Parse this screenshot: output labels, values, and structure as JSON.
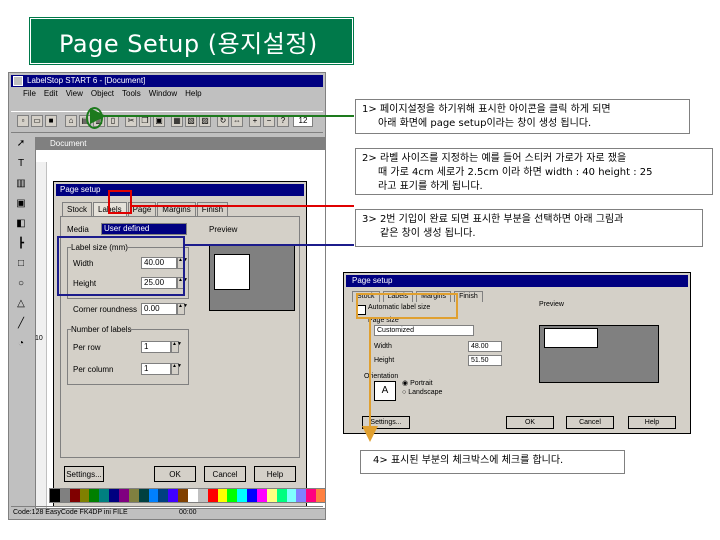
{
  "title": "Page Setup (용지설정)",
  "app": {
    "window_title": "LabelStop START 6 - [Document]",
    "menu": [
      "File",
      "Edit",
      "View",
      "Object",
      "Tools",
      "Window",
      "Help"
    ],
    "document_title": "Document",
    "zoom_value": "12",
    "ruler_marker": "10",
    "status_left": "Code:128 EasyCode FK4DP ini FILE",
    "status_right": "00:00"
  },
  "dialog": {
    "title": "Page setup",
    "tabs": [
      "Stock",
      "Labels",
      "Page",
      "Margins",
      "Finish"
    ],
    "media_label": "Media",
    "media_value": "User defined",
    "preview_label": "Preview",
    "label_size_group": "Label size (mm)",
    "width_label": "Width",
    "width_value": "40.00",
    "height_label": "Height",
    "height_value": "25.00",
    "corner_label": "Corner roundness",
    "corner_value": "0.00",
    "number_group": "Number of labels",
    "per_row_label": "Per row",
    "per_row_value": "1",
    "per_column_label": "Per column",
    "per_column_value": "1",
    "buttons": [
      "Settings...",
      "OK",
      "Cancel",
      "Help"
    ]
  },
  "dialog2": {
    "title": "Page setup",
    "tabs": [
      "Stock",
      "Labels",
      "Margins",
      "Finish"
    ],
    "checkbox_label": "Automatic label size",
    "page_size_label": "Page size",
    "page_size_value": "Customized",
    "width_label": "Width",
    "width_value": "48.00",
    "height_label": "Height",
    "height_value": "51.50",
    "preview_label": "Preview",
    "orientation_label": "Orientation",
    "portrait_label": "Portrait",
    "landscape_label": "Landscape",
    "buttons": [
      "Settings...",
      "OK",
      "Cancel",
      "Help"
    ]
  },
  "callouts": [
    {
      "number": "1>",
      "lines": [
        "페이지설정을 하기위해 표시한 아이콘을 클릭 하게 되면",
        "아래 화면에 page setup이라는 창이 생성 됩니다."
      ]
    },
    {
      "number": "2>",
      "lines": [
        "라벨 사이즈를 지정하는 예를 들어 스티커 가로가 자로 쟀을",
        "때 가로 4cm 세로가 2.5cm 이라 하면 width : 40 height : 25",
        "라고 표기를 하게 됩니다."
      ]
    },
    {
      "number": "3>",
      "lines": [
        "2번 기입이 완료 되면 표시한 부분을 선택하면 아래 그림과",
        "같은 창이 생성 됩니다."
      ]
    },
    {
      "number": "4>",
      "lines": [
        "표시된 부분의 체크박스에 체크를 합니다."
      ]
    }
  ],
  "colors": {
    "banner": "#00794a",
    "arrow_green": "#1d7a1d",
    "arrow_red": "#e00000",
    "box_blue": "#1c1c8c",
    "arrow_orange": "#e0a030"
  },
  "palette": [
    "#000000",
    "#808080",
    "#800000",
    "#808000",
    "#008000",
    "#008080",
    "#000080",
    "#800080",
    "#808040",
    "#004040",
    "#0080ff",
    "#004080",
    "#4000ff",
    "#804000",
    "#ffffff",
    "#c0c0c0",
    "#ff0000",
    "#ffff00",
    "#00ff00",
    "#00ffff",
    "#0000ff",
    "#ff00ff",
    "#ffff80",
    "#00ff80",
    "#80ffff",
    "#8080ff",
    "#ff0080",
    "#ff8040"
  ]
}
